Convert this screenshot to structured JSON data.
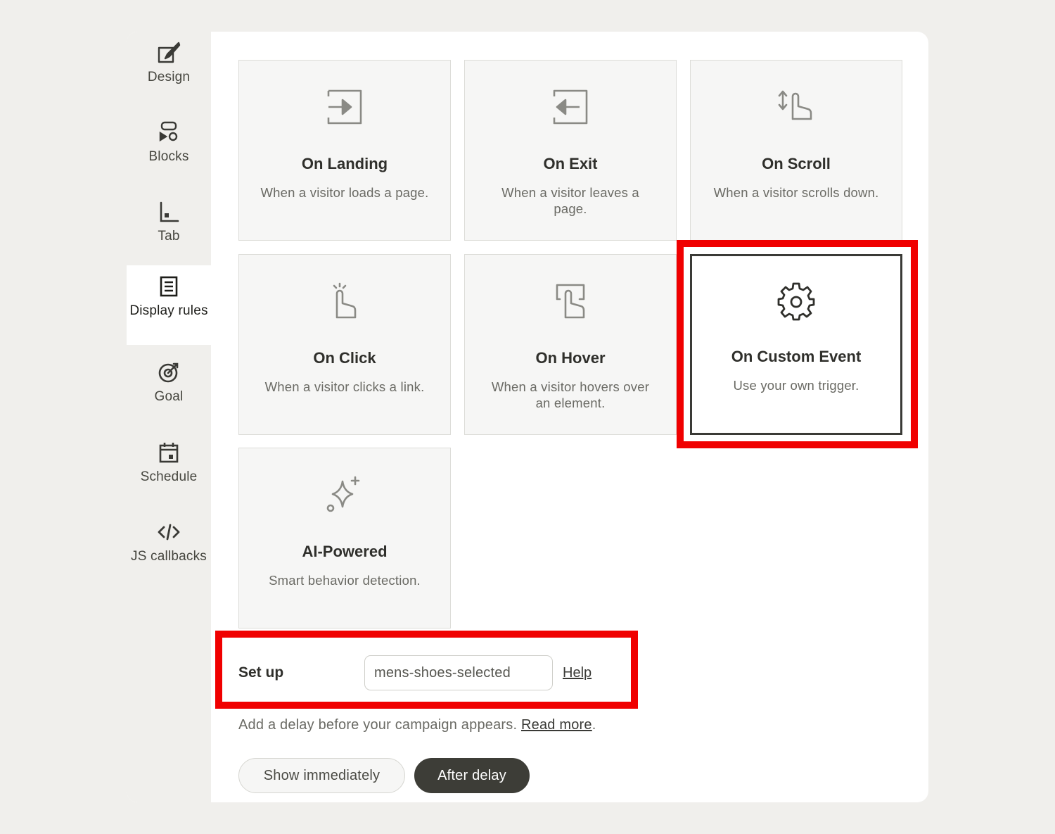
{
  "sidebar": {
    "items": [
      {
        "label": "Design",
        "icon": "design-icon"
      },
      {
        "label": "Blocks",
        "icon": "blocks-icon"
      },
      {
        "label": "Tab",
        "icon": "tab-icon"
      },
      {
        "label": "Display rules",
        "icon": "display-rules-icon",
        "active": true
      },
      {
        "label": "Goal",
        "icon": "goal-icon"
      },
      {
        "label": "Schedule",
        "icon": "schedule-icon"
      },
      {
        "label": "JS callbacks",
        "icon": "code-icon"
      }
    ]
  },
  "triggers": [
    {
      "title": "On Landing",
      "desc": "When a visitor loads a page.",
      "icon": "enter-icon"
    },
    {
      "title": "On Exit",
      "desc": "When a visitor leaves a page.",
      "icon": "exit-icon"
    },
    {
      "title": "On Scroll",
      "desc": "When a visitor scrolls down.",
      "icon": "scroll-hand-icon"
    },
    {
      "title": "On Click",
      "desc": "When a visitor clicks a link.",
      "icon": "click-hand-icon"
    },
    {
      "title": "On Hover",
      "desc": "When a visitor hovers over an element.",
      "icon": "hover-hand-icon"
    },
    {
      "title": "On Custom Event",
      "desc": "Use your own trigger.",
      "icon": "gear-icon",
      "selected": true
    },
    {
      "title": "AI-Powered",
      "desc": "Smart behavior detection.",
      "icon": "sparkle-icon"
    }
  ],
  "setup": {
    "label": "Set up",
    "input_value": "mens-shoes-selected",
    "help_label": "Help"
  },
  "delay": {
    "note": "Add a delay before your campaign appears.",
    "read_more": "Read more",
    "period": ".",
    "show_immediately": "Show immediately",
    "after_delay": "After delay"
  },
  "colors": {
    "highlight": "#f00000",
    "dark_button": "#3d3d37",
    "background": "#f0efec"
  }
}
